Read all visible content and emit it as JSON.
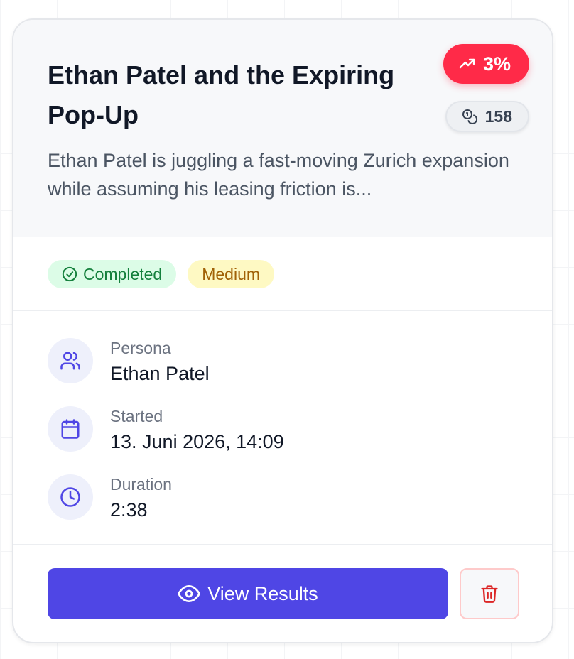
{
  "card": {
    "title": "Ethan Patel and the Expiring Pop-Up",
    "description": "Ethan Patel is juggling a fast-moving Zurich expansion while assuming his leasing friction is...",
    "trend": {
      "label": "3%",
      "icon": "trending-up-icon",
      "color": "#ff2a48"
    },
    "count": {
      "label": "158",
      "icon": "coins-icon"
    },
    "tags": {
      "status": {
        "label": "Completed",
        "icon": "check-circle-icon",
        "color": "#15803d",
        "bg": "#dcfce7"
      },
      "difficulty": {
        "label": "Medium",
        "color": "#a16207",
        "bg": "#fef9c3"
      }
    },
    "details": {
      "persona": {
        "label": "Persona",
        "value": "Ethan Patel",
        "icon": "users-icon"
      },
      "started": {
        "label": "Started",
        "value": "13. Juni 2026, 14:09",
        "icon": "calendar-icon"
      },
      "duration": {
        "label": "Duration",
        "value": "2:38",
        "icon": "clock-icon"
      }
    },
    "actions": {
      "view_label": "View Results",
      "view_icon": "eye-icon",
      "delete_icon": "trash-icon",
      "accent": "#4f46e5",
      "danger": "#dc2626"
    }
  }
}
